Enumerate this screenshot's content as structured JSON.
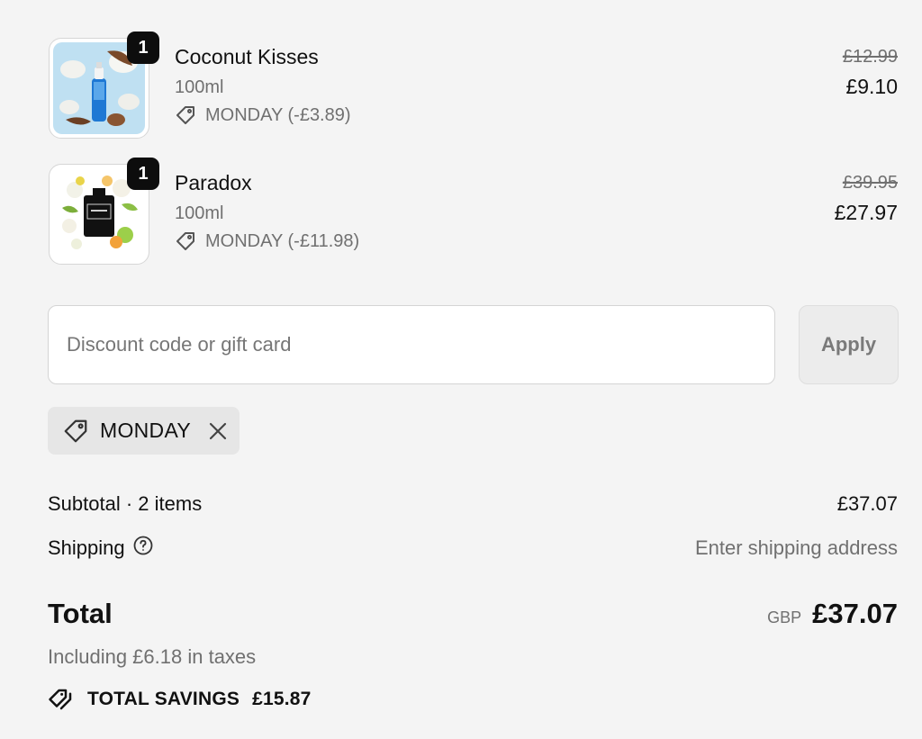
{
  "items": [
    {
      "name": "Coconut Kisses",
      "variant": "100ml",
      "discount": "MONDAY (-£3.89)",
      "original_price": "£12.99",
      "price": "£9.10",
      "quantity": "1"
    },
    {
      "name": "Paradox",
      "variant": "100ml",
      "discount": "MONDAY (-£11.98)",
      "original_price": "£39.95",
      "price": "£27.97",
      "quantity": "1"
    }
  ],
  "discount_form": {
    "placeholder": "Discount code or gift card",
    "value": "",
    "apply_label": "Apply"
  },
  "applied_code": {
    "label": "MONDAY",
    "icons": {
      "tag": "tag-icon",
      "remove": "close-icon"
    }
  },
  "summary": {
    "subtotal_label": "Subtotal · 2 items",
    "subtotal_value": "£37.07",
    "shipping_label": "Shipping",
    "shipping_value": "Enter shipping address",
    "total_label": "Total",
    "currency": "GBP",
    "total_value": "£37.07",
    "tax_note": "Including £6.18 in taxes",
    "savings_label": "TOTAL SAVINGS",
    "savings_value": "£15.87"
  },
  "colors": {
    "background": "#f4f4f4",
    "badge": "#0d0d0d",
    "muted_text": "#707070",
    "chip_bg": "#e6e6e6"
  }
}
